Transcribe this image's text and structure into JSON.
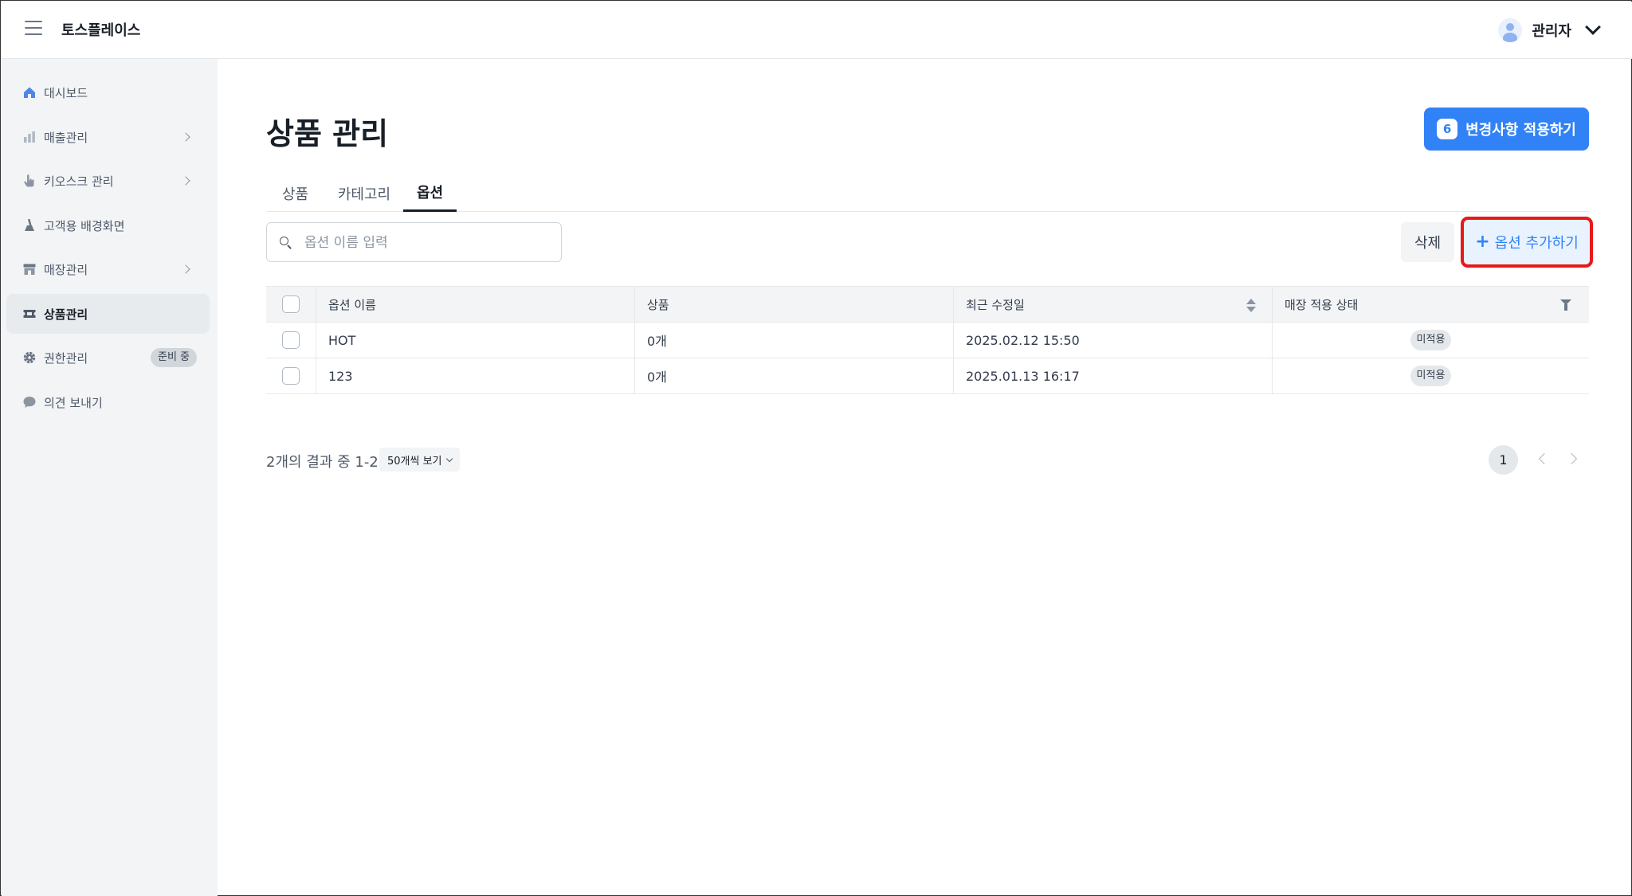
{
  "app": {
    "brand": "토스플레이스"
  },
  "header": {
    "user_name": "관리자"
  },
  "sidebar": {
    "items": [
      {
        "label": "대시보드",
        "icon": "home-icon",
        "has_arrow": false
      },
      {
        "label": "매출관리",
        "icon": "bar-chart-icon",
        "has_arrow": true
      },
      {
        "label": "키오스크 관리",
        "icon": "pointer-hand-icon",
        "has_arrow": true
      },
      {
        "label": "고객용 배경화면",
        "icon": "brush-icon",
        "has_arrow": false
      },
      {
        "label": "매장관리",
        "icon": "store-icon",
        "has_arrow": true
      },
      {
        "label": "상품관리",
        "icon": "ticket-icon",
        "has_arrow": false,
        "active": true
      },
      {
        "label": "권한관리",
        "icon": "gear-icon",
        "has_arrow": false,
        "badge": "준비 중"
      },
      {
        "label": "의견 보내기",
        "icon": "chat-bubble-icon",
        "has_arrow": false
      }
    ]
  },
  "main": {
    "title": "상품 관리",
    "apply_button": {
      "count": "6",
      "label": "변경사항 적용하기"
    },
    "tabs": [
      {
        "label": "상품",
        "active": false
      },
      {
        "label": "카테고리",
        "active": false
      },
      {
        "label": "옵션",
        "active": true
      }
    ],
    "search": {
      "placeholder": "옵션 이름 입력",
      "value": ""
    },
    "delete_label": "삭제",
    "add_label": "옵션 추가하기"
  },
  "table": {
    "columns": [
      "옵션 이름",
      "상품",
      "최근 수정일",
      "매장 적용 상태"
    ],
    "rows": [
      {
        "name": "HOT",
        "products": "0개",
        "updated": "2025.02.12 15:50",
        "status": "미적용"
      },
      {
        "name": "123",
        "products": "0개",
        "updated": "2025.01.13 16:17",
        "status": "미적용"
      }
    ]
  },
  "footer": {
    "result_text": "2개의 결과 중 1-2",
    "per_page": "50개씩 보기",
    "current_page": "1"
  },
  "colors": {
    "primary": "#3182f6",
    "highlight_box": "#e81919",
    "sidebar_bg": "#f2f4f6"
  }
}
